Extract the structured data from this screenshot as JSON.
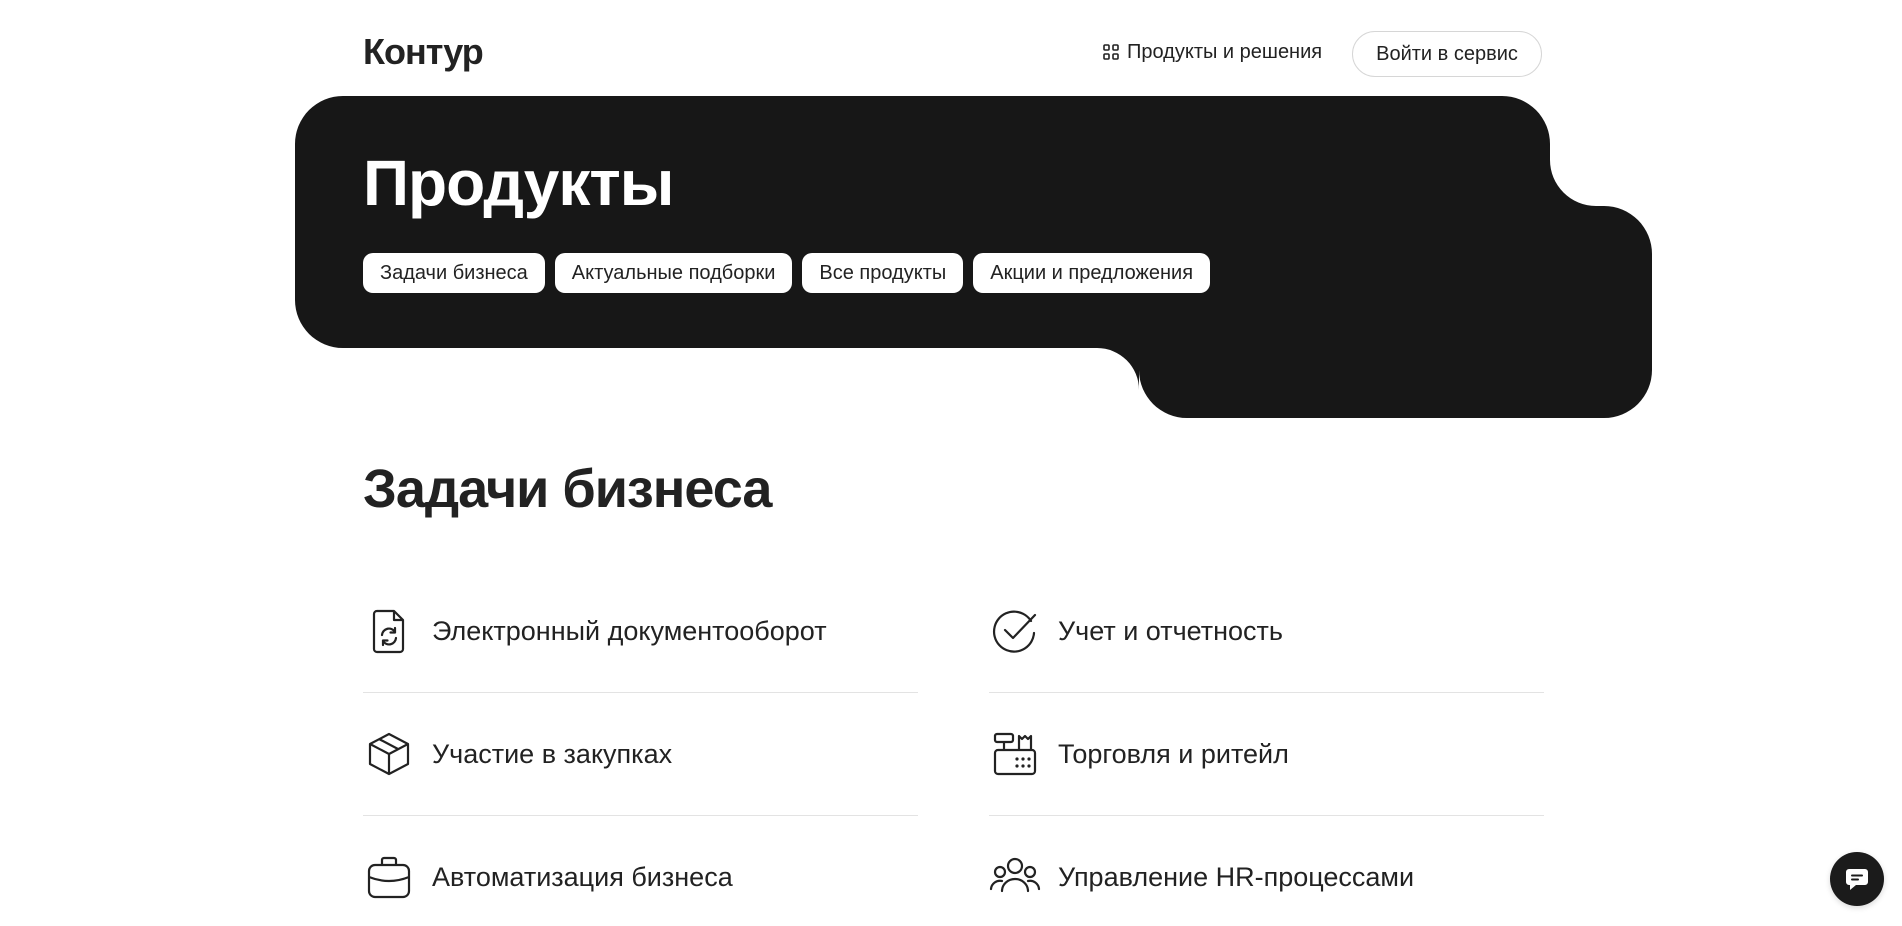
{
  "header": {
    "logo": "Контур",
    "products_link": "Продукты и решения",
    "login_button": "Войти в сервис"
  },
  "hero": {
    "title": "Продукты",
    "chips": [
      "Задачи бизнеса",
      "Актуальные подборки",
      "Все продукты",
      "Акции и предложения"
    ]
  },
  "section": {
    "title": "Задачи бизнеса",
    "items": [
      {
        "label": "Электронный документооборот",
        "icon": "document-sync-icon"
      },
      {
        "label": "Учет и отчетность",
        "icon": "check-circle-icon"
      },
      {
        "label": "Участие в закупках",
        "icon": "box-icon"
      },
      {
        "label": "Торговля и ритейл",
        "icon": "cash-register-icon"
      },
      {
        "label": "Автоматизация бизнеса",
        "icon": "briefcase-icon"
      },
      {
        "label": "Управление HR-процессами",
        "icon": "people-group-icon"
      }
    ]
  },
  "colors": {
    "hero_bg": "#171717",
    "text": "#222222",
    "divider": "#e3e3e3"
  }
}
